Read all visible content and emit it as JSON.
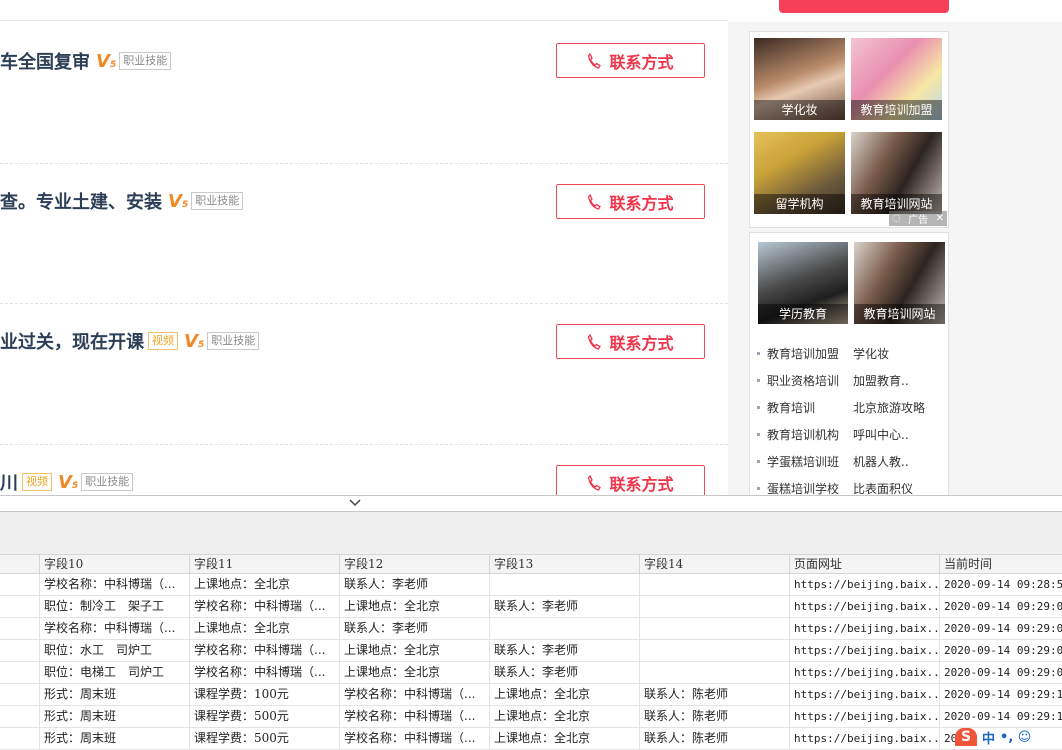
{
  "listings": [
    {
      "title": "车全国复审",
      "video": "",
      "v_text": "V",
      "v_sub": "5",
      "tag": "职业技能",
      "button": "联系方式"
    },
    {
      "title": "查。专业土建、安装",
      "video": "",
      "v_text": "V",
      "v_sub": "5",
      "tag": "职业技能",
      "button": "联系方式"
    },
    {
      "title": "业过关，现在开课",
      "video": "视频",
      "v_text": "V",
      "v_sub": "5",
      "tag": "职业技能",
      "button": "联系方式"
    },
    {
      "title": "川",
      "video": "视频",
      "v_text": "V",
      "v_sub": "5",
      "tag": "职业技能",
      "button": "联系方式"
    }
  ],
  "sidebar": {
    "ads_top": [
      "学化妆",
      "教育培训加盟",
      "留学机构",
      "教育培训网站"
    ],
    "ad_mark": "广告",
    "ads_bottom": [
      "学历教育",
      "教育培训网站"
    ],
    "links": [
      [
        "教育培训加盟",
        "学化妆"
      ],
      [
        "职业资格培训",
        "加盟教育.."
      ],
      [
        "教育培训",
        "北京旅游攻略"
      ],
      [
        "教育培训机构",
        "呼叫中心.."
      ],
      [
        "学蛋糕培训班",
        "机器人教.."
      ],
      [
        "蛋糕培训学校",
        "比表面积仪"
      ]
    ]
  },
  "grid": {
    "headers": [
      "字段10",
      "字段11",
      "字段12",
      "字段13",
      "字段14",
      "页面网址",
      "当前时间"
    ],
    "rows": [
      [
        "学校名称：中科博瑞（...",
        "上课地点：全北京",
        "联系人：李老师",
        "",
        "",
        "https://beijing.baix...",
        "2020-09-14 09:28:54."
      ],
      [
        "职位：制冷工　架子工",
        "学校名称：中科博瑞（...",
        "上课地点：全北京",
        "联系人：李老师",
        "",
        "https://beijing.baix...",
        "2020-09-14 09:29:00."
      ],
      [
        "学校名称：中科博瑞（...",
        "上课地点：全北京",
        "联系人：李老师",
        "",
        "",
        "https://beijing.baix...",
        "2020-09-14 09:29:02."
      ],
      [
        "职位：水工　司炉工",
        "学校名称：中科博瑞（...",
        "上课地点：全北京",
        "联系人：李老师",
        "",
        "https://beijing.baix...",
        "2020-09-14 09:29:04."
      ],
      [
        "职位：电梯工　司炉工",
        "学校名称：中科博瑞（...",
        "上课地点：全北京",
        "联系人：李老师",
        "",
        "https://beijing.baix...",
        "2020-09-14 09:29:07."
      ],
      [
        "形式：周末班",
        "课程学费：100元",
        "学校名称：中科博瑞（...",
        "上课地点：全北京",
        "联系人：陈老师",
        "https://beijing.baix...",
        "2020-09-14 09:29:10."
      ],
      [
        "形式：周末班",
        "课程学费：500元",
        "学校名称：中科博瑞（...",
        "上课地点：全北京",
        "联系人：陈老师",
        "https://beijing.baix...",
        "2020-09-14 09:29:14."
      ],
      [
        "形式：周末班",
        "课程学费：500元",
        "学校名称：中科博瑞（...",
        "上课地点：全北京",
        "联系人：陈老师",
        "https://beijing.baix...",
        "20"
      ]
    ]
  },
  "tray": {
    "ime": "S",
    "lang": "中",
    "extra": "•, ☺"
  }
}
